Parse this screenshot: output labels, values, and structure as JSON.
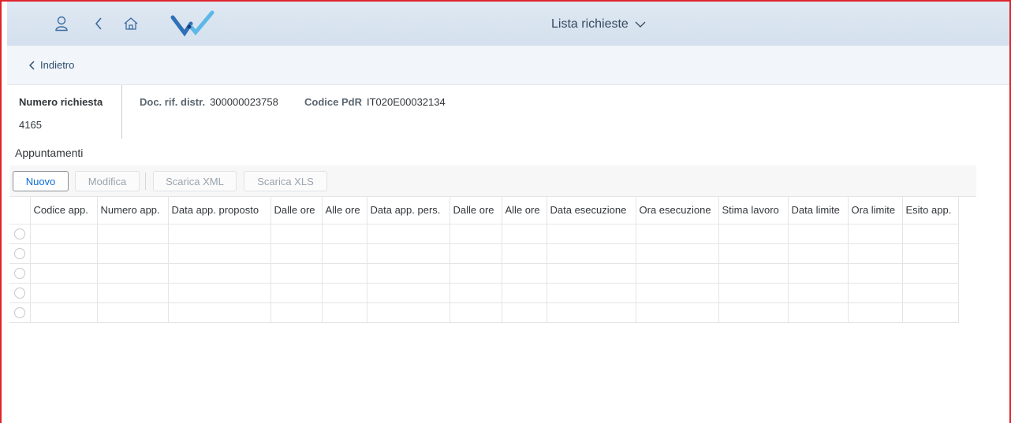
{
  "shell": {
    "title": "Lista richieste",
    "icons": [
      "user-icon",
      "back-icon",
      "home-icon",
      "logo"
    ]
  },
  "nav": {
    "back_label": "Indietro"
  },
  "header": {
    "request_number_label": "Numero richiesta",
    "request_number_value": "4165",
    "doc_label": "Doc. rif. distr.",
    "doc_value": "300000023758",
    "pdr_label": "Codice PdR",
    "pdr_value": "IT020E00032134"
  },
  "section": {
    "title": "Appuntamenti"
  },
  "toolbar": {
    "new_label": "Nuovo",
    "edit_label": "Modifica",
    "xml_label": "Scarica XML",
    "xls_label": "Scarica XLS"
  },
  "table": {
    "columns": [
      "Codice app.",
      "Numero app.",
      "Data app. proposto",
      "Dalle ore",
      "Alle ore",
      "Data app. pers.",
      "Dalle ore",
      "Alle ore",
      "Data esecuzione",
      "Ora esecuzione",
      "Stima lavoro",
      "Data limite",
      "Ora limite",
      "Esito app."
    ],
    "rows": [
      [
        "",
        "",
        "",
        "",
        "",
        "",
        "",
        "",
        "",
        "",
        "",
        "",
        "",
        ""
      ],
      [
        "",
        "",
        "",
        "",
        "",
        "",
        "",
        "",
        "",
        "",
        "",
        "",
        "",
        ""
      ],
      [
        "",
        "",
        "",
        "",
        "",
        "",
        "",
        "",
        "",
        "",
        "",
        "",
        "",
        ""
      ],
      [
        "",
        "",
        "",
        "",
        "",
        "",
        "",
        "",
        "",
        "",
        "",
        "",
        "",
        ""
      ],
      [
        "",
        "",
        "",
        "",
        "",
        "",
        "",
        "",
        "",
        "",
        "",
        "",
        "",
        ""
      ]
    ]
  },
  "colors": {
    "accent": "#0a6ed1",
    "shell_bg": "#dbe5f0",
    "frame_border": "#e0242b"
  }
}
